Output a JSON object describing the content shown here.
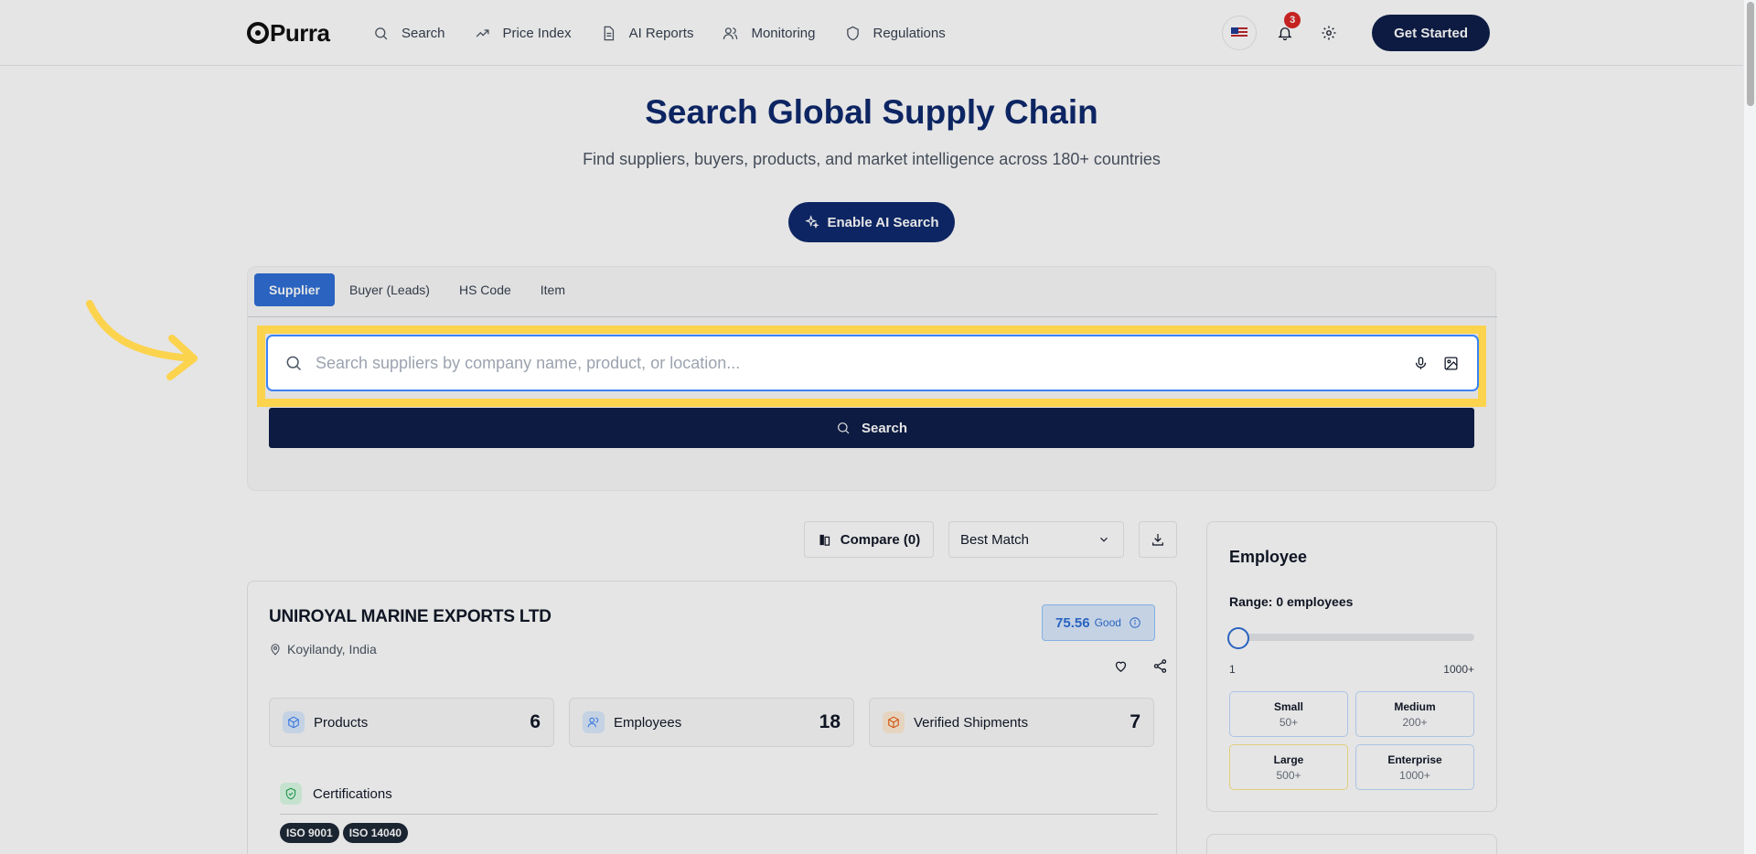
{
  "header": {
    "logo": "Purra",
    "nav": [
      {
        "label": "Search",
        "icon": "search-icon"
      },
      {
        "label": "Price Index",
        "icon": "trending-up-icon"
      },
      {
        "label": "AI Reports",
        "icon": "document-icon"
      },
      {
        "label": "Monitoring",
        "icon": "users-icon"
      },
      {
        "label": "Regulations",
        "icon": "shield-icon"
      }
    ],
    "notification_count": "3",
    "cta_label": "Get Started"
  },
  "hero": {
    "title": "Search Global Supply Chain",
    "subtitle": "Find suppliers, buyers, products, and market intelligence across 180+ countries",
    "ai_button_label": "Enable AI Search"
  },
  "search": {
    "tabs": [
      "Supplier",
      "Buyer (Leads)",
      "HS Code",
      "Item"
    ],
    "active_tab": "Supplier",
    "input_value": "",
    "placeholder": "Search suppliers by company name, product, or location...",
    "button_label": "Search"
  },
  "toolbar": {
    "compare_label": "Compare (0)",
    "sort_value": "Best Match"
  },
  "result": {
    "company": "UNIROYAL MARINE EXPORTS LTD",
    "location": "Koyilandy, India",
    "score": "75.56",
    "score_label": "Good",
    "stats": [
      {
        "label": "Products",
        "value": "6",
        "icon": "box-icon",
        "color": "#3b82f6",
        "bg": "#dbeafe"
      },
      {
        "label": "Employees",
        "value": "18",
        "icon": "users-icon",
        "color": "#3b82f6",
        "bg": "#dbeafe"
      },
      {
        "label": "Verified Shipments",
        "value": "7",
        "icon": "package-icon",
        "color": "#ea580c",
        "bg": "#ffedd5"
      }
    ],
    "certifications_label": "Certifications",
    "certifications": [
      "ISO 9001",
      "ISO 14040"
    ]
  },
  "filter": {
    "title": "Employee",
    "range_label": "Range: 0 employees",
    "range_min": "1",
    "range_max": "1000+",
    "slider_value": 0,
    "sizes": [
      {
        "name": "Small",
        "count": "50+"
      },
      {
        "name": "Medium",
        "count": "200+"
      },
      {
        "name": "Large",
        "count": "500+"
      },
      {
        "name": "Enterprise",
        "count": "1000+"
      }
    ]
  },
  "colors": {
    "primary_navy": "#0f1f4a",
    "accent_blue": "#2f6fd6",
    "highlight_yellow": "#fcd34d"
  }
}
